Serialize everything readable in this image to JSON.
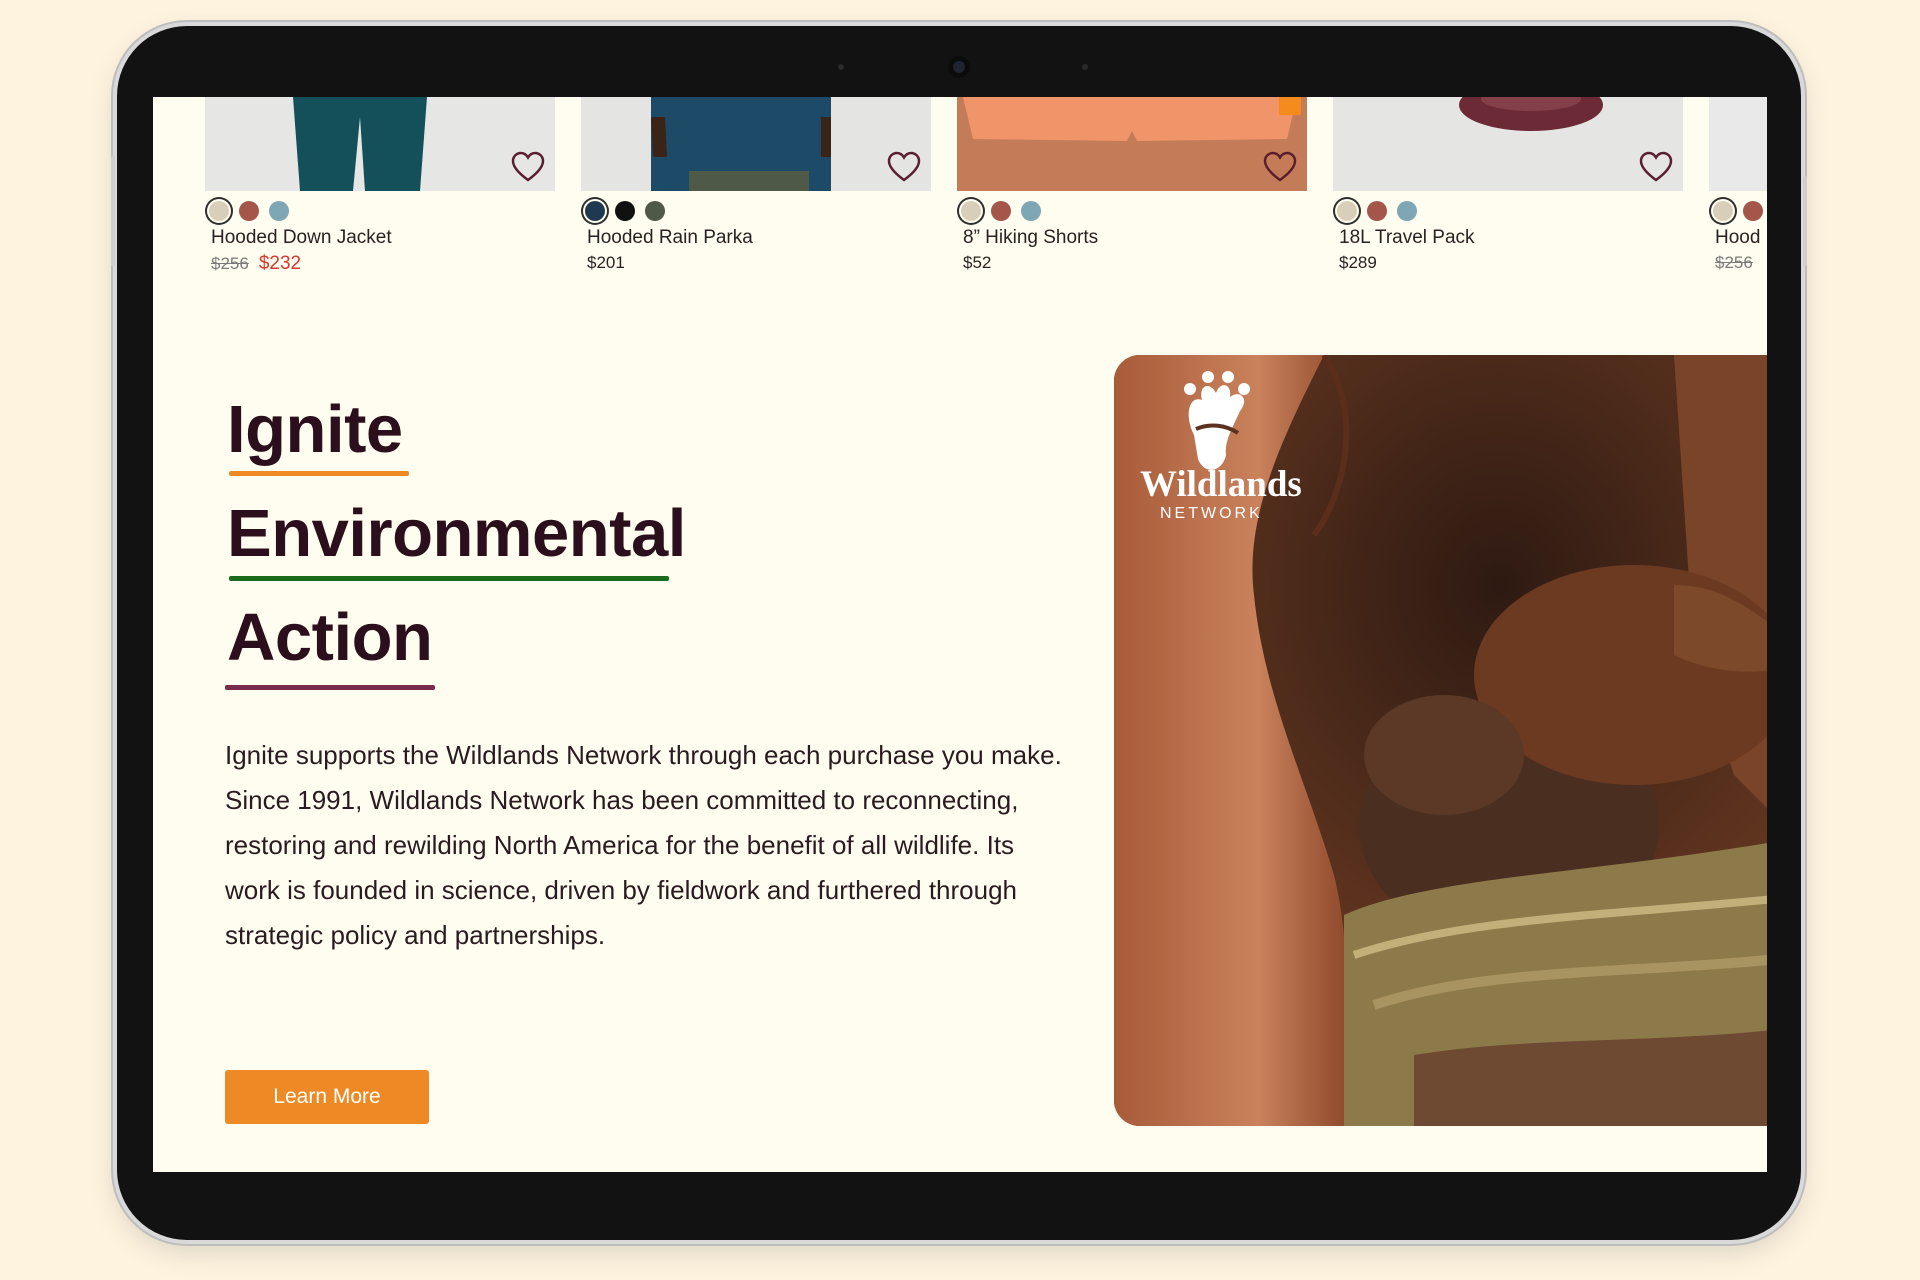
{
  "products": [
    {
      "name": "Hooded Down Jacket",
      "price_original": "$256",
      "price_sale": "$232",
      "swatches": [
        "#d9cfb8",
        "#a4564a",
        "#7fa6b4"
      ],
      "selected_swatch": 0
    },
    {
      "name": "Hooded Rain Parka",
      "price": "$201",
      "swatches": [
        "#1e3950",
        "#111111",
        "#4e5a47"
      ],
      "selected_swatch": 0
    },
    {
      "name": "8” Hiking Shorts",
      "price": "$52",
      "swatches": [
        "#d9cfb8",
        "#a4564a",
        "#7fa6b4"
      ],
      "selected_swatch": 0
    },
    {
      "name": "18L Travel Pack",
      "price": "$289",
      "swatches": [
        "#d9cfb8",
        "#a4564a",
        "#7fa6b4"
      ],
      "selected_swatch": 0
    },
    {
      "name": "Hood",
      "price_original": "$256",
      "swatches": [
        "#d9cfb8",
        "#a4564a"
      ],
      "selected_swatch": 0
    }
  ],
  "feature": {
    "heading_lines": [
      "Ignite",
      "Environmental",
      "Action"
    ],
    "underline_colors": [
      "#ee8a25",
      "#1c6b1c",
      "#7a2a4a"
    ],
    "body": "Ignite supports the Wildlands Network through each purchase you make. Since 1991, Wildlands Network has been committed to reconnecting, restoring and rewilding North America for the benefit of all wildlife. Its work is founded in science, driven by fieldwork and furthered through strategic policy and partnerships.",
    "cta_label": "Learn More",
    "logo_name": "Wildlands",
    "logo_sub": "NETWORK"
  },
  "colors": {
    "accent": "#ee8a25",
    "heading": "#2b0f1c",
    "sale": "#d8362e",
    "background": "#fffdf0"
  }
}
